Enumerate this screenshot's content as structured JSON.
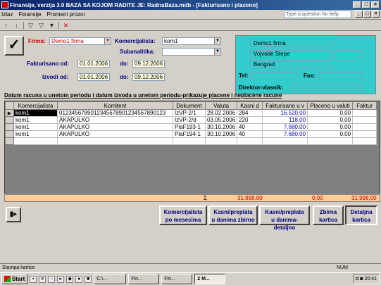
{
  "window": {
    "title": "Finansije, verzija 3.0     BAZA SA KOJOM RADITE JE: RadnaBaza.mdb - [Fakturisano i placeno]"
  },
  "menu": {
    "items": [
      "Izlaz",
      "Finansije",
      "Promeni prozor"
    ],
    "help_placeholder": "Type a question for help"
  },
  "form": {
    "firma_label": "Firma:",
    "firma_value": "Demo1 firma",
    "komercijalista_label": "Komercijalista:",
    "komercijalista_value": "kom1",
    "subanalitika_label": "Subanalitika:",
    "subanalitika_value": "",
    "fakturisano_label": "Fakturisano od:",
    "fakturisano_od": "01.01.2006",
    "do_label": "do:",
    "fakturisano_do": "09.12.2006",
    "izvodi_label": "Izvodi od:",
    "izvodi_od": "01.01.2006",
    "izvodi_do": "09.12.2006"
  },
  "info": {
    "firma": "Demo1 firma",
    "adresa": "Vojvode Stepe",
    "grad": "Beograd",
    "tel_label": "Tel:",
    "fax_label": "Fax:",
    "direktor_label": "Direktor-vlasnik:"
  },
  "description": "Datum racuna u unetom periodu i datum izvoda u unetom periodu-prikazuje placene i neplacene racune",
  "grid": {
    "columns": [
      "Komercijalista",
      "Komitent",
      "Dokument",
      "Valuta",
      "Kasni d",
      "Fakturisano u v",
      "Placeno u valuti",
      "Faktur"
    ],
    "rows": [
      [
        "kom1",
        "0123456789012345678901234567890123",
        "IzVP-2/1",
        "28.02.2006",
        "284",
        "16.520,00",
        "0,00",
        ""
      ],
      [
        "kom1",
        "AKAPULKO",
        "IzVP-2/d",
        "03.05.2006",
        "220",
        "118,00",
        "0,00",
        ""
      ],
      [
        "kom1",
        "AKAPULKO",
        "PlaF193-1",
        "30.10.2006",
        "40",
        "7.680,00",
        "0,00",
        ""
      ],
      [
        "kom1",
        "AKAPULKO",
        "PlaF194-1",
        "30.10.2006",
        "40",
        "7.680,00",
        "0,00",
        ""
      ]
    ]
  },
  "totals": {
    "sigma": "Σ",
    "fakturisano": "31.998,00",
    "placeno": "0,00",
    "ukupno": "31.998,00"
  },
  "buttons": {
    "komercijalista": "Komercijalista\npo mesecima",
    "kasni_zbirno": "Kasni/preplata\nu danima zbirno",
    "kasni_detaljno": "Kasni/preplata\nu danima-detaljno",
    "zbirna": "Zbirna\nkartica",
    "detaljna": "Detaljna\nkartica"
  },
  "status": {
    "text": "Stampa kartice",
    "num": "NUM"
  },
  "taskbar": {
    "start": "Start",
    "tasks": [
      "C:\\...",
      "Fin...",
      "Fin...",
      "2 M..."
    ],
    "clock": "20:41"
  }
}
